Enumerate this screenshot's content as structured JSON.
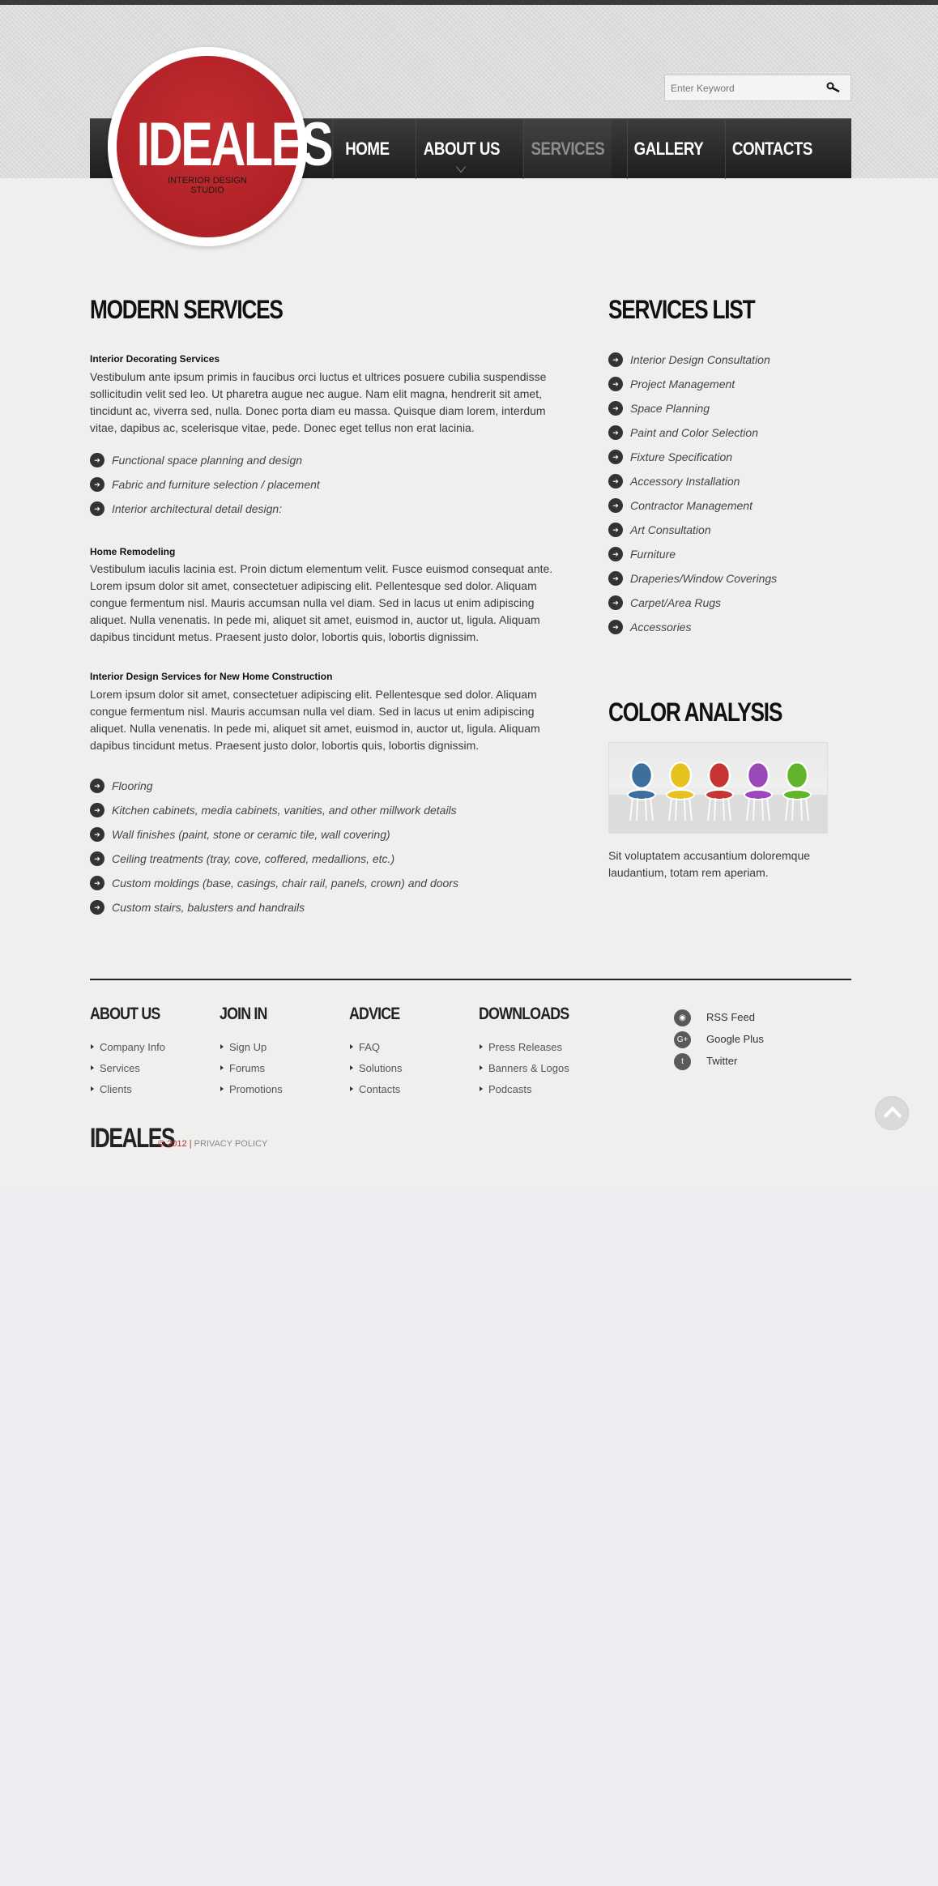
{
  "logo": {
    "title": "IDEALES",
    "subtitle_line1": "INTERIOR DESIGN",
    "subtitle_line2": "STUDIO"
  },
  "search": {
    "placeholder": "Enter Keyword",
    "icon": "search-icon"
  },
  "nav": {
    "items": [
      {
        "label": "HOME"
      },
      {
        "label": "ABOUT US"
      },
      {
        "label": "SERVICES",
        "active": true
      },
      {
        "label": "GALLERY"
      },
      {
        "label": "CONTACTS"
      }
    ]
  },
  "main": {
    "heading": "MODERN SERVICES",
    "section1": {
      "title": "Interior Decorating Services",
      "text": "Vestibulum ante ipsum primis in faucibus orci luctus et ultrices posuere cubilia suspendisse sollicitudin velit sed leo. Ut pharetra augue nec augue. Nam elit magna, hendrerit sit amet, tincidunt ac, viverra sed, nulla. Donec porta diam eu massa. Quisque diam lorem, interdum vitae, dapibus ac, scelerisque vitae, pede. Donec eget tellus non erat lacinia.",
      "bullets": [
        "Functional space planning and design",
        "Fabric and furniture selection / placement",
        "Interior architectural detail design:"
      ]
    },
    "section2": {
      "title": "Home Remodeling",
      "text": "Vestibulum iaculis lacinia est. Proin dictum elementum velit. Fusce euismod consequat ante. Lorem ipsum dolor sit amet, consectetuer adipiscing elit. Pellentesque sed dolor. Aliquam congue fermentum nisl. Mauris accumsan nulla vel diam. Sed in lacus ut enim adipiscing aliquet. Nulla venenatis. In pede mi, aliquet sit amet, euismod in, auctor ut, ligula. Aliquam dapibus tincidunt metus. Praesent justo dolor, lobortis quis, lobortis dignissim."
    },
    "section3": {
      "title": "Interior Design Services for New Home Construction",
      "text": "Lorem ipsum dolor sit amet, consectetuer adipiscing elit. Pellentesque sed dolor. Aliquam congue fermentum nisl. Mauris accumsan nulla vel diam. Sed in lacus ut enim adipiscing aliquet. Nulla venenatis. In pede mi, aliquet sit amet, euismod in, auctor ut, ligula. Aliquam dapibus tincidunt metus. Praesent justo dolor, lobortis quis, lobortis dignissim.",
      "bullets": [
        "Flooring",
        "Kitchen cabinets, media cabinets, vanities, and other millwork details",
        "Wall finishes (paint, stone or ceramic tile, wall covering)",
        "Ceiling treatments (tray, cove, coffered, medallions, etc.)",
        "Custom moldings (base, casings, chair rail, panels, crown) and doors",
        "Custom stairs, balusters and handrails"
      ]
    }
  },
  "sidebar": {
    "services_heading": "SERVICES LIST",
    "services": [
      "Interior Design Consultation",
      "Project Management",
      "Space Planning",
      "Paint and Color Selection",
      "Fixture Specification",
      "Accessory Installation",
      "Contractor Management",
      "Art Consultation",
      "Furniture",
      "Draperies/Window Coverings",
      "Carpet/Area Rugs",
      "Accessories"
    ],
    "color_heading": "COLOR ANALYSIS",
    "color_text": "Sit voluptatem accusantium doloremque laudantium, totam rem aperiam.",
    "chair_colors": [
      "#3d6f9c",
      "#e6c21f",
      "#c63434",
      "#9a49b8",
      "#62b52a"
    ]
  },
  "footer": {
    "columns": [
      {
        "heading": "ABOUT US",
        "links": [
          "Company Info",
          "Services",
          "Clients"
        ]
      },
      {
        "heading": "JOIN IN",
        "links": [
          "Sign Up",
          "Forums",
          "Promotions"
        ]
      },
      {
        "heading": "ADVICE",
        "links": [
          "FAQ",
          "Solutions",
          "Contacts"
        ]
      },
      {
        "heading": "DOWNLOADS",
        "links": [
          "Press Releases",
          "Banners & Logos",
          "Podcasts"
        ]
      }
    ],
    "social": [
      {
        "label": "RSS Feed",
        "icon": "rss-icon",
        "glyph": "◉"
      },
      {
        "label": "Google Plus",
        "icon": "google-plus-icon",
        "glyph": "G+"
      },
      {
        "label": "Twitter",
        "icon": "twitter-icon",
        "glyph": "t"
      }
    ],
    "logo": "IDEALES",
    "copyright": "© 2012 |",
    "privacy": "PRIVACY POLICY"
  },
  "colors": {
    "brand_red": "#b32025",
    "nav_dark": "#2a2a2a",
    "active_nav": "#8d8d8d"
  }
}
